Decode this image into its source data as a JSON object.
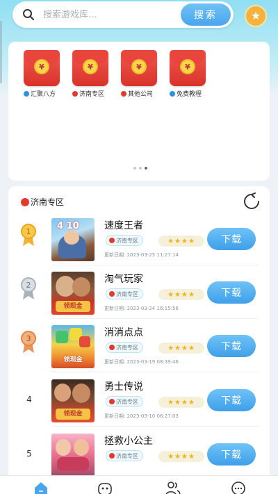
{
  "search": {
    "placeholder": "搜索游戏库...",
    "button_label": "搜索"
  },
  "shortcuts": [
    {
      "label": "汇聚八方",
      "dot_color": "#2f8fe0",
      "icon": "red-envelope-icon"
    },
    {
      "label": "济南专区",
      "dot_color": "#e23b2e",
      "icon": "red-envelope-icon"
    },
    {
      "label": "其他公司",
      "dot_color": "#e23b2e",
      "icon": "red-envelope-icon"
    },
    {
      "label": "免费教程",
      "dot_color": "#2f8fe0",
      "icon": "red-envelope-icon"
    }
  ],
  "shortcut_coin_glyph": "¥",
  "section": {
    "title": "济南专区"
  },
  "games": [
    {
      "rank": "1",
      "name": "速度王者",
      "tag": "济南专区",
      "stars": "★★★★",
      "date": "更新日期:  2023-03-25 11:27:14",
      "download": "下载"
    },
    {
      "rank": "2",
      "name": "淘气玩家",
      "tag": "济南专区",
      "stars": "★★★★",
      "date": "更新日期:  2023-03-24 16:15:56",
      "download": "下载"
    },
    {
      "rank": "3",
      "name": "消消点点",
      "tag": "济南专区",
      "stars": "★★★★",
      "date": "更新日期:  2023-03-19 08:39:46",
      "download": "下载"
    },
    {
      "rank": "4",
      "name": "勇士传说",
      "tag": "济南专区",
      "stars": "★★★★",
      "date": "更新日期:  2023-03-10 06:27:03",
      "download": "下载"
    },
    {
      "rank": "5",
      "name": "拯救小公主",
      "tag": "济南专区",
      "stars": "★★★★",
      "date": "",
      "download": "下载"
    }
  ],
  "thumb_texts": {
    "t1": "4 10",
    "t2": "领现金",
    "t3": "领现金",
    "t4": "领现金"
  },
  "colors": {
    "accent_blue": "#4aa5ec",
    "band_cyan": "#8fdff2",
    "envelope_red": "#d9322a",
    "star_gold": "#f2b21e"
  }
}
